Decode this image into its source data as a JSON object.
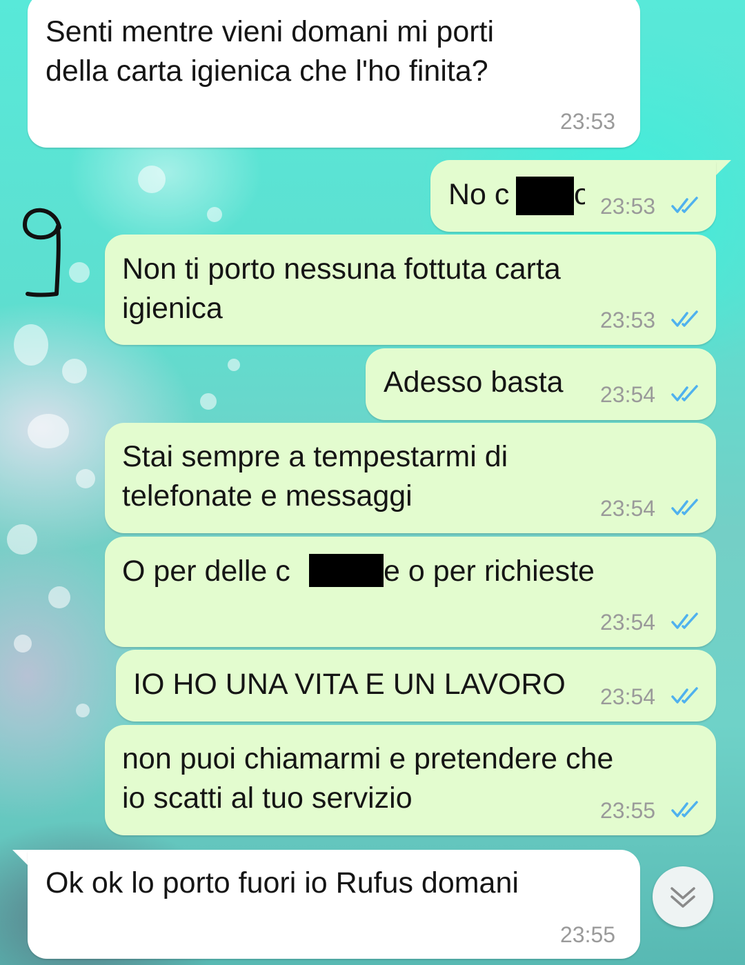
{
  "chat": {
    "messages": [
      {
        "direction": "incoming",
        "line1": "Senti mentre vieni domani mi porti",
        "line2": "della carta igienica che l'ho finita?",
        "time": "23:53"
      },
      {
        "direction": "outgoing",
        "line1": "No c",
        "line1_after": "o",
        "time": "23:53",
        "status": "read"
      },
      {
        "direction": "outgoing",
        "line1": "Non ti porto nessuna fottuta carta",
        "line2": "igienica",
        "time": "23:53",
        "status": "read"
      },
      {
        "direction": "outgoing",
        "line1": "Adesso basta",
        "time": "23:54",
        "status": "read"
      },
      {
        "direction": "outgoing",
        "line1": "Stai sempre a tempestarmi di",
        "line2": "telefonate e messaggi",
        "time": "23:54",
        "status": "read"
      },
      {
        "direction": "outgoing",
        "line1": "O per delle c",
        "line1_after": "e o per richieste",
        "time": "23:54",
        "status": "read"
      },
      {
        "direction": "outgoing",
        "line1": "IO HO UNA VITA E UN LAVORO",
        "time": "23:54",
        "status": "read"
      },
      {
        "direction": "outgoing",
        "line1": "non puoi chiamarmi e pretendere che",
        "line2": "io scatti al tuo servizio",
        "time": "23:55",
        "status": "read"
      },
      {
        "direction": "incoming",
        "line1": "Ok ok lo porto fuori io Rufus domani",
        "time": "23:55"
      }
    ],
    "annotation": "9"
  },
  "colors": {
    "incoming_bubble": "#ffffff",
    "outgoing_bubble": "#e3fccf",
    "read_ticks": "#4fb1ee",
    "timestamp": "#9a9a9a"
  },
  "icons": {
    "read_status": "double-check-icon",
    "scroll_down": "double-chevron-down-icon"
  }
}
